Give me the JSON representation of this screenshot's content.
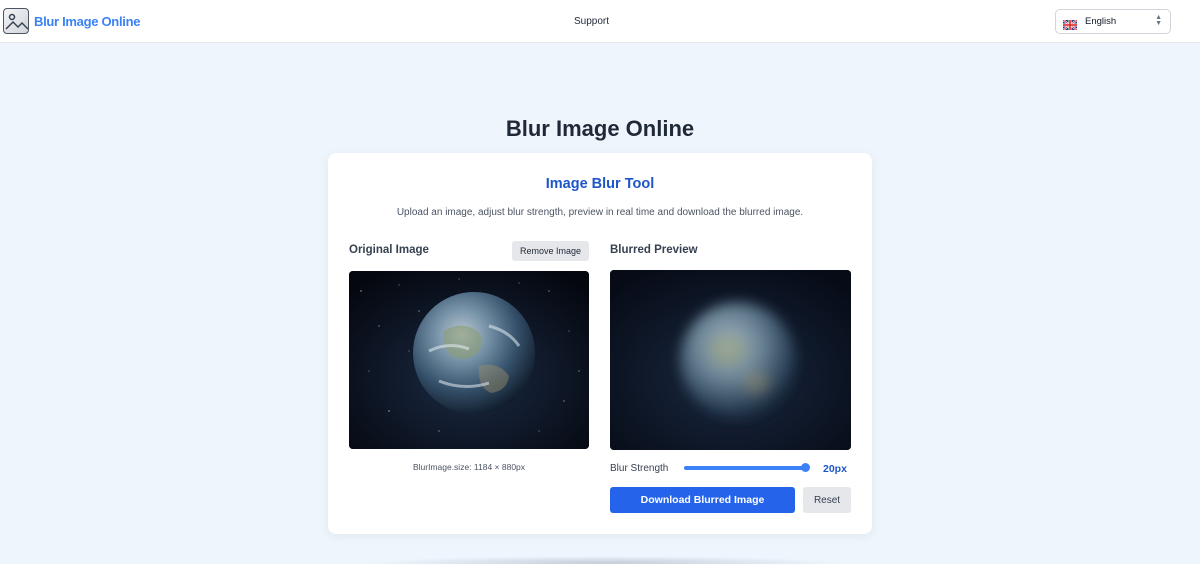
{
  "header": {
    "logo_text": "Blur Image Online",
    "logo_icon": "image-icon",
    "nav": {
      "support_label": "Support"
    },
    "language": {
      "selected": "English",
      "flag_icon": "uk-flag-icon",
      "arrows_icon": "chevron-up-down-icon"
    }
  },
  "page_title": "Blur Image Online",
  "tool": {
    "title": "Image Blur Tool",
    "description": "Upload an image, adjust blur strength, preview in real time and download the blurred image.",
    "original": {
      "label": "Original Image",
      "remove_label": "Remove Image",
      "size_text": "BlurImage.size: 1184 × 880px"
    },
    "preview": {
      "label": "Blurred Preview"
    },
    "blur": {
      "label": "Blur Strength",
      "value_text": "20px",
      "value_fraction": 1.0
    },
    "download_label": "Download Blurred Image",
    "reset_label": "Reset"
  },
  "colors": {
    "accent": "#2563eb",
    "title_blue": "#1e55c8",
    "logo_blue": "#3b82f6",
    "page_bg": "#eef5fd"
  }
}
